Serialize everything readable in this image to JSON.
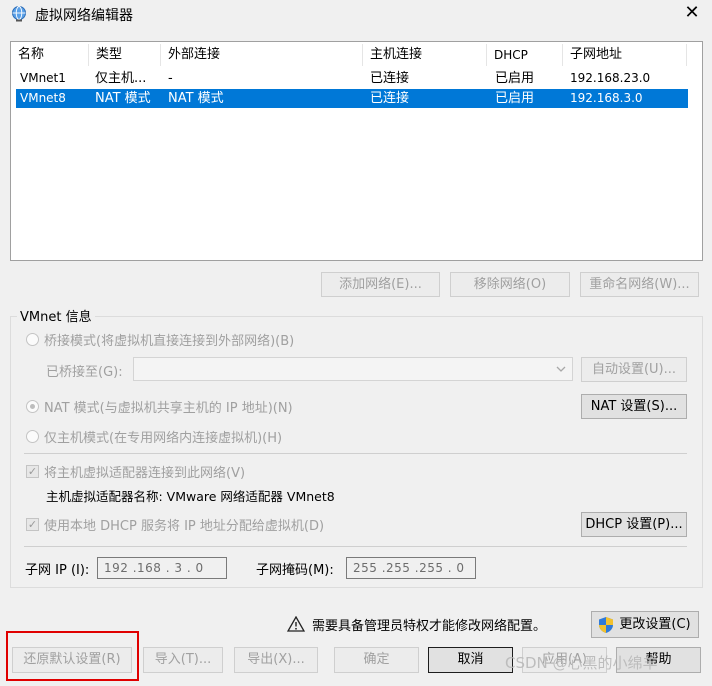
{
  "window": {
    "title": "虚拟网络编辑器",
    "close_glyph": "✕"
  },
  "table": {
    "columns": [
      "名称",
      "类型",
      "外部连接",
      "主机连接",
      "DHCP",
      "子网地址"
    ],
    "rows": [
      [
        "VMnet1",
        "仅主机...",
        "-",
        "已连接",
        "已启用",
        "192.168.23.0"
      ],
      [
        "VMnet8",
        "NAT 模式",
        "NAT 模式",
        "已连接",
        "已启用",
        "192.168.3.0"
      ]
    ],
    "selected_row": 1
  },
  "list_buttons": {
    "add": "添加网络(E)...",
    "remove": "移除网络(O)",
    "rename": "重命名网络(W)..."
  },
  "vmnet_info": {
    "group_label": "VMnet 信息",
    "bridge_label": "桥接模式(将虚拟机直接连接到外部网络)(B)",
    "bridged_to_label": "已桥接至(G):",
    "auto_button": "自动设置(U)...",
    "nat_label": "NAT 模式(与虚拟机共享主机的 IP 地址)(N)",
    "nat_settings_button": "NAT 设置(S)...",
    "host_only_label": "仅主机模式(在专用网络内连接虚拟机)(H)",
    "connect_adapter_label": "将主机虚拟适配器连接到此网络(V)",
    "adapter_name_label": "主机虚拟适配器名称: VMware 网络适配器 VMnet8",
    "dhcp_label": "使用本地 DHCP 服务将 IP 地址分配给虚拟机(D)",
    "dhcp_settings_button": "DHCP 设置(P)...",
    "subnet_ip_label": "子网 IP (I):",
    "subnet_ip_value": "192 .168 .  3  .  0",
    "subnet_mask_label": "子网掩码(M):",
    "subnet_mask_value": "255 .255 .255 .  0"
  },
  "admin": {
    "notice": "需要具备管理员特权才能修改网络配置。",
    "change_button": "更改设置(C)"
  },
  "footer": {
    "restore": "还原默认设置(R)",
    "import": "导入(T)...",
    "export": "导出(X)...",
    "ok": "确定",
    "cancel": "取消",
    "apply": "应用(A)",
    "help": "帮助"
  },
  "watermark": "CSDN @心黑的小绵羊",
  "colors": {
    "selection": "#0078d7",
    "highlight_box": "#e00000"
  }
}
